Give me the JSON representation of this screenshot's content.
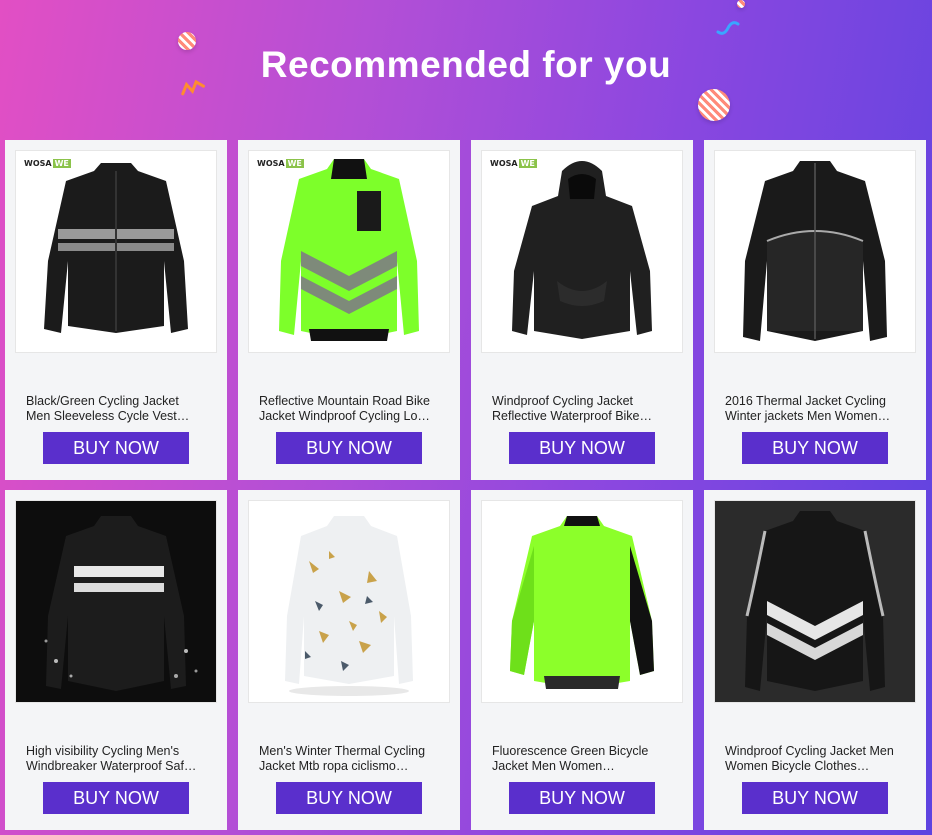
{
  "heading": "Recommended for you",
  "colors": {
    "button": "#5a2fcc",
    "background_start": "#e24fc4",
    "background_end": "#5d43e0",
    "card": "#f4f5f7"
  },
  "decorations": [
    "striped-ball-icon",
    "confetti-icon"
  ],
  "products": [
    {
      "title": "Black/Green Cycling Jacket\nMen Sleeveless Cycle Vest…",
      "button_label": "BUY NOW",
      "brand_main": "WOSA",
      "brand_accent": "WE",
      "image": "black-cycling-jacket-icon"
    },
    {
      "title": "Reflective Mountain Road Bike\nJacket Windproof Cycling Lo…",
      "button_label": "BUY NOW",
      "brand_main": "WOSA",
      "brand_accent": "WE",
      "image": "green-reflective-jacket-icon"
    },
    {
      "title": "Windproof Cycling Jacket\nReflective Waterproof Bike…",
      "button_label": "BUY NOW",
      "brand_main": "WOSA",
      "brand_accent": "WE",
      "image": "black-hooded-jacket-icon"
    },
    {
      "title": "2016 Thermal Jacket Cycling\nWinter jackets Men Women…",
      "button_label": "BUY NOW",
      "image": "thermal-jacket-icon"
    },
    {
      "title": "High visibility Cycling Men's\nWindbreaker Waterproof Saf…",
      "button_label": "BUY NOW",
      "image": "high-visibility-jacket-icon"
    },
    {
      "title": "Men's Winter Thermal Cycling\nJacket Mtb ropa ciclismo…",
      "button_label": "BUY NOW",
      "image": "printed-thermal-jersey-icon"
    },
    {
      "title": "Fluorescence Green Bicycle\nJacket Men Women…",
      "button_label": "BUY NOW",
      "image": "fluorescent-green-jacket-icon"
    },
    {
      "title": "Windproof Cycling Jacket Men\nWomen Bicycle Clothes…",
      "button_label": "BUY NOW",
      "image": "reflective-vest-jacket-icon"
    }
  ]
}
